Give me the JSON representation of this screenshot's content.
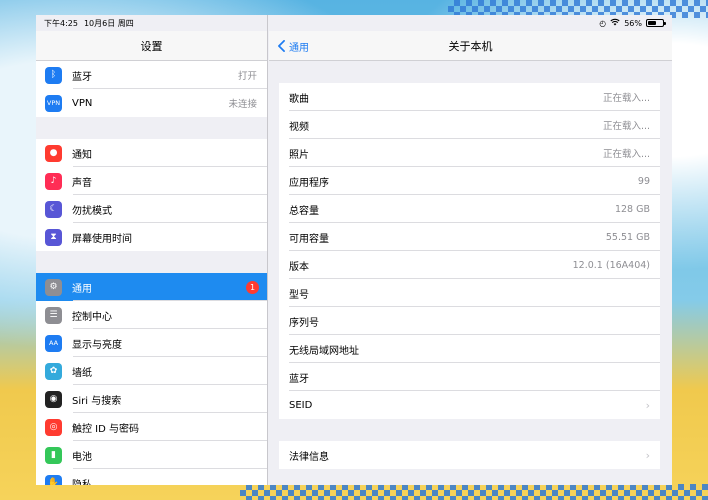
{
  "status_bar": {
    "time": "下午4:25",
    "date": "10月6日 周四",
    "battery": "56%",
    "battery_level": 0.56
  },
  "master": {
    "title": "设置",
    "group1": [
      {
        "label": "蓝牙",
        "value": "打开",
        "icon": "bluetooth-icon",
        "color": "#1e7cf2"
      },
      {
        "label": "VPN",
        "value": "未连接",
        "icon": "vpn-icon",
        "color": "#1e7cf2",
        "glyph": "VPN"
      }
    ],
    "group2": [
      {
        "label": "通知",
        "icon": "notifications-icon",
        "color": "#ff3b30"
      },
      {
        "label": "声音",
        "icon": "sound-icon",
        "color": "#ff2d55"
      },
      {
        "label": "勿扰模式",
        "icon": "moon-icon",
        "color": "#5856d6"
      },
      {
        "label": "屏幕使用时间",
        "icon": "hourglass-icon",
        "color": "#5856d6"
      }
    ],
    "group3": [
      {
        "label": "通用",
        "icon": "gear-icon",
        "color": "#8e8e93",
        "badge": "1",
        "selected": true
      },
      {
        "label": "控制中心",
        "icon": "control-center-icon",
        "color": "#8e8e93"
      },
      {
        "label": "显示与亮度",
        "icon": "display-brightness-icon",
        "color": "#1e7cf2",
        "glyph": "AA"
      },
      {
        "label": "墙纸",
        "icon": "wallpaper-icon",
        "color": "#34aadc"
      },
      {
        "label": "Siri 与搜索",
        "icon": "siri-icon",
        "color": "#222222"
      },
      {
        "label": "触控 ID 与密码",
        "icon": "fingerprint-icon",
        "color": "#ff3b30"
      },
      {
        "label": "电池",
        "icon": "battery-icon",
        "color": "#34c759"
      },
      {
        "label": "隐私",
        "icon": "hand-icon",
        "color": "#1e7cf2"
      }
    ]
  },
  "detail": {
    "back_label": "通用",
    "title": "关于本机",
    "rows": [
      {
        "label": "歌曲",
        "value": "正在载入..."
      },
      {
        "label": "视频",
        "value": "正在载入..."
      },
      {
        "label": "照片",
        "value": "正在载入..."
      },
      {
        "label": "应用程序",
        "value": "99"
      },
      {
        "label": "总容量",
        "value": "128 GB"
      },
      {
        "label": "可用容量",
        "value": "55.51 GB"
      },
      {
        "label": "版本",
        "value": "12.0.1 (16A404)"
      },
      {
        "label": "型号",
        "value": ""
      },
      {
        "label": "序列号",
        "value": ""
      },
      {
        "label": "无线局域网地址",
        "value": ""
      },
      {
        "label": "蓝牙",
        "value": ""
      },
      {
        "label": "SEID",
        "value": "",
        "chevron": true
      }
    ],
    "legal": {
      "label": "法律信息",
      "chevron": true
    }
  }
}
